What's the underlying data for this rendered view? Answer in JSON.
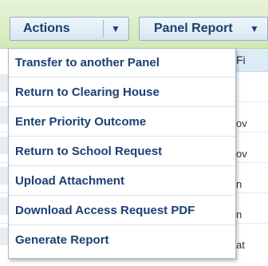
{
  "toolbar": {
    "actions_label": "Actions",
    "actions_caret": "▼",
    "panel_report_label": "Panel Report",
    "panel_report_caret": "▼"
  },
  "table": {
    "column_header_partial": "Fi",
    "row_fragments": [
      "ov",
      "ov",
      "n",
      "n",
      "at"
    ]
  },
  "menu": {
    "items": [
      "Transfer to another Panel",
      "Return to Clearing House",
      "Enter Priority Outcome",
      "Return to School Request",
      "Upload Attachment",
      "Download Access Request PDF",
      "Generate Report"
    ]
  },
  "colors": {
    "toolbar_bg": "#d3e8b6",
    "button_text": "#1a3f6e",
    "menu_text": "#1c3f73",
    "menu_border": "#a9bccb"
  }
}
